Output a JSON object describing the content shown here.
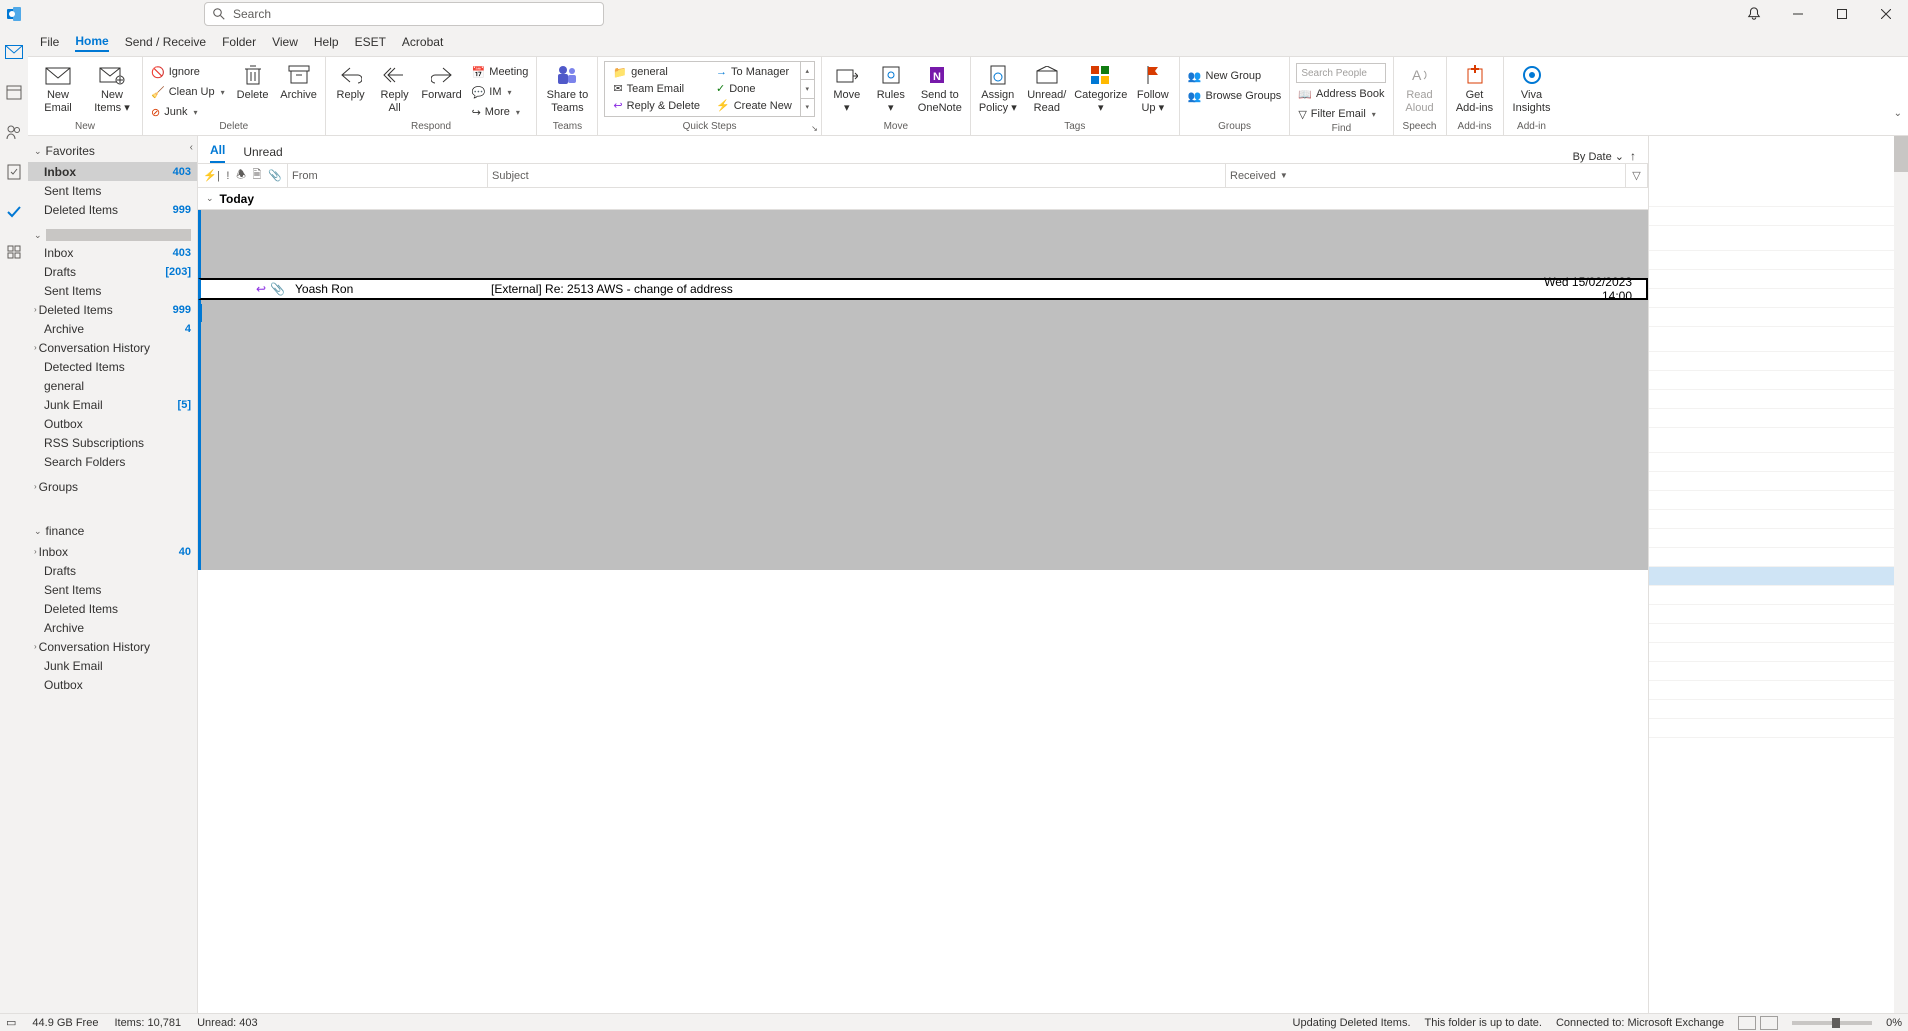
{
  "title_bar": {
    "search_placeholder": "Search"
  },
  "menu_tabs": [
    "File",
    "Home",
    "Send / Receive",
    "Folder",
    "View",
    "Help",
    "ESET",
    "Acrobat"
  ],
  "menu_active": "Home",
  "ribbon": {
    "new": {
      "new_email": "New\nEmail",
      "new_items": "New\nItems",
      "label": "New"
    },
    "delete": {
      "ignore": "Ignore",
      "cleanup": "Clean Up",
      "junk": "Junk",
      "delete": "Delete",
      "archive": "Archive",
      "label": "Delete"
    },
    "respond": {
      "reply": "Reply",
      "reply_all": "Reply\nAll",
      "forward": "Forward",
      "meeting": "Meeting",
      "im": "IM",
      "more": "More",
      "label": "Respond"
    },
    "teams": {
      "share": "Share to\nTeams",
      "label": "Teams"
    },
    "quick_steps": {
      "general": "general",
      "team_email": "Team Email",
      "reply_delete": "Reply & Delete",
      "to_manager": "To Manager",
      "done": "Done",
      "create_new": "Create New",
      "label": "Quick Steps"
    },
    "move": {
      "move": "Move",
      "rules": "Rules",
      "onenote": "Send to\nOneNote",
      "label": "Move"
    },
    "tags": {
      "assign": "Assign\nPolicy",
      "unread": "Unread/\nRead",
      "categorize": "Categorize",
      "followup": "Follow\nUp",
      "label": "Tags"
    },
    "groups": {
      "new_group": "New Group",
      "browse": "Browse Groups",
      "label": "Groups"
    },
    "find": {
      "search_people": "Search People",
      "address_book": "Address Book",
      "filter": "Filter Email",
      "label": "Find"
    },
    "speech": {
      "read_aloud": "Read\nAloud",
      "label": "Speech"
    },
    "addins": {
      "get": "Get\nAdd-ins",
      "label": "Add-ins"
    },
    "viva": {
      "viva": "Viva\nInsights",
      "label": "Add-in"
    }
  },
  "folder_pane": {
    "favorites_label": "Favorites",
    "favorites": [
      {
        "name": "Inbox",
        "count": "403",
        "selected": true
      },
      {
        "name": "Sent Items"
      },
      {
        "name": "Deleted Items",
        "count": "999"
      }
    ],
    "account1": [
      {
        "name": "Inbox",
        "count": "403"
      },
      {
        "name": "Drafts",
        "count": "[203]"
      },
      {
        "name": "Sent Items"
      },
      {
        "name": "Deleted Items",
        "count": "999",
        "expandable": true
      },
      {
        "name": "Archive",
        "count": "4"
      },
      {
        "name": "Conversation History",
        "expandable": true
      },
      {
        "name": "Detected Items"
      },
      {
        "name": "general"
      },
      {
        "name": "Junk Email",
        "count": "[5]"
      },
      {
        "name": "Outbox"
      },
      {
        "name": "RSS Subscriptions"
      },
      {
        "name": "Search Folders"
      }
    ],
    "groups_label": "Groups",
    "finance_label": "finance",
    "finance": [
      {
        "name": "Inbox",
        "count": "40",
        "expandable": true
      },
      {
        "name": "Drafts"
      },
      {
        "name": "Sent Items"
      },
      {
        "name": "Deleted Items"
      },
      {
        "name": "Archive"
      },
      {
        "name": "Conversation History",
        "expandable": true
      },
      {
        "name": "Junk Email"
      },
      {
        "name": "Outbox"
      }
    ]
  },
  "msg_list": {
    "tab_all": "All",
    "tab_unread": "Unread",
    "sort_by": "By Date",
    "col_from": "From",
    "col_subject": "Subject",
    "col_received": "Received",
    "group_today": "Today",
    "message": {
      "from": "Yoash Ron",
      "subject": "[External] Re: 2513 AWS - change of address",
      "received": "Wed 15/02/2023 14:00"
    }
  },
  "status": {
    "free": "44.9 GB Free",
    "items": "Items: 10,781",
    "unread": "Unread: 403",
    "updating": "Updating Deleted Items.",
    "uptodate": "This folder is up to date.",
    "connected": "Connected to: Microsoft Exchange",
    "zoom": "0%"
  }
}
